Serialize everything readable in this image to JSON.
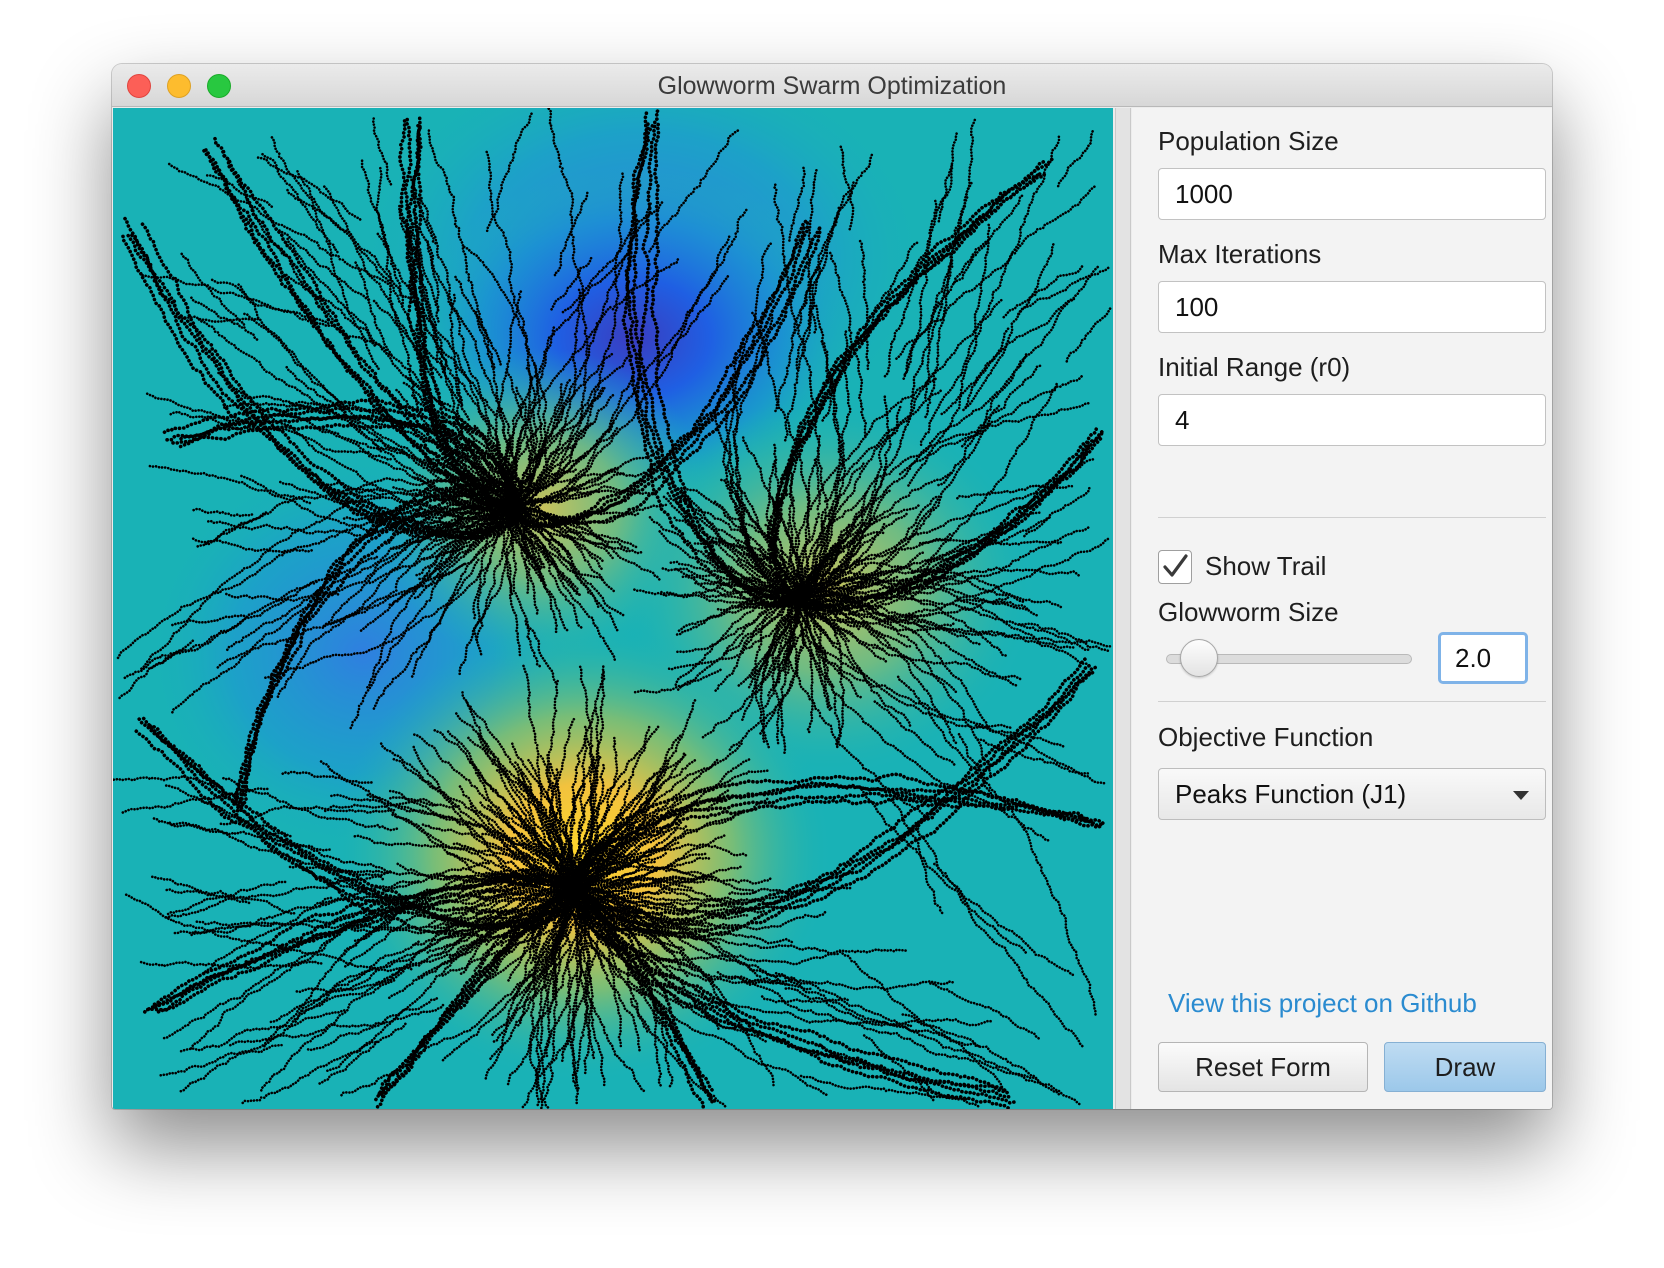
{
  "window": {
    "title": "Glowworm Swarm Optimization"
  },
  "form": {
    "population_size": {
      "label": "Population Size",
      "value": "1000"
    },
    "max_iterations": {
      "label": "Max Iterations",
      "value": "100"
    },
    "initial_range": {
      "label": "Initial Range (r0)",
      "value": "4"
    },
    "show_trail": {
      "label": "Show Trail",
      "checked": true
    },
    "glowworm_size": {
      "label": "Glowworm Size",
      "value": "2.0",
      "slider_fraction": 0.07
    },
    "objective_function": {
      "label": "Objective Function",
      "selected": "Peaks Function (J1)"
    }
  },
  "footer": {
    "github_link": "View this project on Github",
    "reset_label": "Reset Form",
    "draw_label": "Draw"
  },
  "visualization": {
    "background_color": "#19b2b6",
    "trail_color": "#000000",
    "icons": [
      "close-icon",
      "minimize-icon",
      "zoom-icon",
      "checkmark-icon",
      "chevron-down-icon"
    ]
  }
}
